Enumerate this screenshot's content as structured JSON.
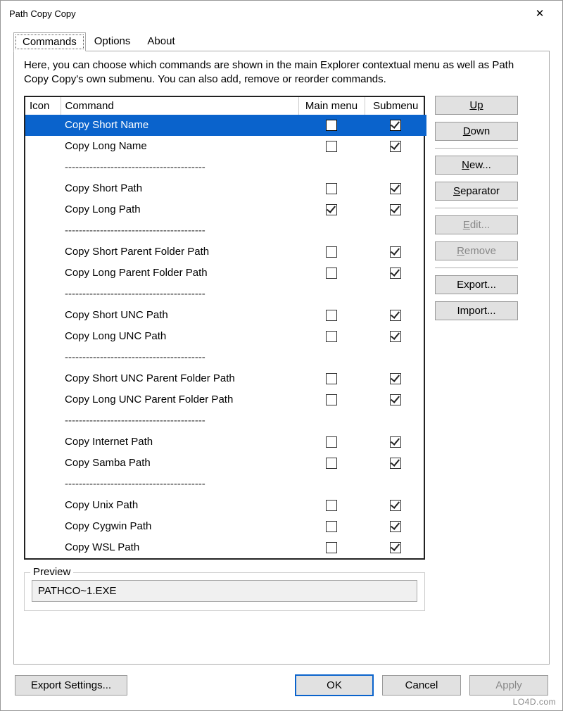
{
  "window": {
    "title": "Path Copy Copy"
  },
  "tabs": [
    {
      "label": "Commands",
      "active": true
    },
    {
      "label": "Options",
      "active": false
    },
    {
      "label": "About",
      "active": false
    }
  ],
  "description": "Here, you can choose which commands are shown in the main Explorer contextual menu as well as Path Copy Copy's own submenu. You can also add, remove or reorder commands.",
  "headers": {
    "icon": "Icon",
    "command": "Command",
    "main": "Main menu",
    "sub": "Submenu"
  },
  "separator_text": "----------------------------------------",
  "rows": [
    {
      "type": "cmd",
      "label": "Copy Short Name",
      "main": false,
      "sub": true,
      "selected": true
    },
    {
      "type": "cmd",
      "label": "Copy Long Name",
      "main": false,
      "sub": true
    },
    {
      "type": "sep"
    },
    {
      "type": "cmd",
      "label": "Copy Short Path",
      "main": false,
      "sub": true
    },
    {
      "type": "cmd",
      "label": "Copy Long Path",
      "main": true,
      "sub": true
    },
    {
      "type": "sep"
    },
    {
      "type": "cmd",
      "label": "Copy Short Parent Folder Path",
      "main": false,
      "sub": true
    },
    {
      "type": "cmd",
      "label": "Copy Long Parent Folder Path",
      "main": false,
      "sub": true
    },
    {
      "type": "sep"
    },
    {
      "type": "cmd",
      "label": "Copy Short UNC Path",
      "main": false,
      "sub": true
    },
    {
      "type": "cmd",
      "label": "Copy Long UNC Path",
      "main": false,
      "sub": true
    },
    {
      "type": "sep"
    },
    {
      "type": "cmd",
      "label": "Copy Short UNC Parent Folder Path",
      "main": false,
      "sub": true
    },
    {
      "type": "cmd",
      "label": "Copy Long UNC Parent Folder Path",
      "main": false,
      "sub": true
    },
    {
      "type": "sep"
    },
    {
      "type": "cmd",
      "label": "Copy Internet Path",
      "main": false,
      "sub": true
    },
    {
      "type": "cmd",
      "label": "Copy Samba Path",
      "main": false,
      "sub": true
    },
    {
      "type": "sep"
    },
    {
      "type": "cmd",
      "label": "Copy Unix Path",
      "main": false,
      "sub": true
    },
    {
      "type": "cmd",
      "label": "Copy Cygwin Path",
      "main": false,
      "sub": true
    },
    {
      "type": "cmd",
      "label": "Copy WSL Path",
      "main": false,
      "sub": true
    }
  ],
  "side": {
    "up": "Up",
    "down": "Down",
    "new": "New...",
    "separator": "Separator",
    "edit": "Edit...",
    "remove": "Remove",
    "export": "Export...",
    "import": "Import..."
  },
  "preview": {
    "legend": "Preview",
    "value": "PATHCO~1.EXE"
  },
  "bottom": {
    "export_settings": "Export Settings...",
    "ok": "OK",
    "cancel": "Cancel",
    "apply": "Apply"
  },
  "watermark": "LO4D.com"
}
